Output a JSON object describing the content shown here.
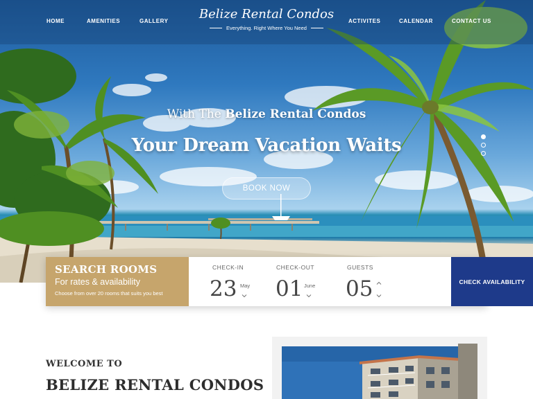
{
  "nav": {
    "home": "HOME",
    "amenities": "AMENITIES",
    "gallery": "GALLERY",
    "activities": "ACTIVITES",
    "calendar": "CALENDAR",
    "contact": "CONTACT US"
  },
  "brand": {
    "title": "Belize Rental Condos",
    "tagline": "Everything. Right Where You Need"
  },
  "hero": {
    "subtitle_prefix": "With The",
    "subtitle_brand": "Belize Rental Condos",
    "title": "Your Dream Vacation Waits",
    "book_button": "BOOK NOW",
    "slide_count": 3,
    "active_slide": 1
  },
  "search": {
    "title": "SEARCH ROOMS",
    "subtitle": "For rates & availability",
    "description": "Choose from over 20 rooms that suits you best",
    "checkin": {
      "label": "CHECK-IN",
      "day": "23",
      "month": "May"
    },
    "checkout": {
      "label": "CHECK-OUT",
      "day": "01",
      "month": "June"
    },
    "guests": {
      "label": "GUESTS",
      "count": "05"
    },
    "check_button": "CHECK AVAILABILITY"
  },
  "welcome": {
    "small": "WELCOME TO",
    "big": "BELIZE RENTAL CONDOS"
  },
  "colors": {
    "gold": "#c6a56c",
    "navy": "#1e3a8a",
    "sky": "#2f79bf"
  }
}
